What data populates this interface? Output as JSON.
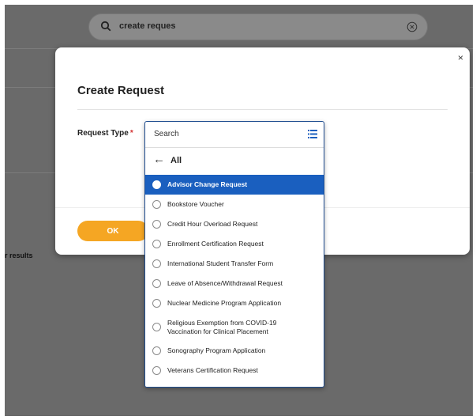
{
  "global_search": {
    "query": "create reques"
  },
  "background": {
    "results_text": "r results"
  },
  "modal": {
    "close_label": "×",
    "title": "Create Request",
    "field_label": "Request Type",
    "required_mark": "*",
    "ok_label": "OK"
  },
  "dropdown": {
    "search_placeholder": "Search",
    "back_arrow": "←",
    "back_label": "All",
    "selected_index": 0,
    "options": [
      {
        "label": "Advisor Change Request"
      },
      {
        "label": "Bookstore Voucher"
      },
      {
        "label": "Credit Hour Overload Request"
      },
      {
        "label": "Enrollment Certification Request"
      },
      {
        "label": "International Student Transfer Form"
      },
      {
        "label": "Leave of Absence/Withdrawal Request"
      },
      {
        "label": "Nuclear Medicine Program Application"
      },
      {
        "label": "Religious Exemption from COVID-19 Vaccination for Clinical Placement"
      },
      {
        "label": "Sonography Program Application"
      },
      {
        "label": "Veterans Certification Request"
      }
    ]
  },
  "colors": {
    "accent_orange": "#f5a623",
    "selected_blue": "#1a5fbf",
    "required_red": "#d32f2f"
  }
}
